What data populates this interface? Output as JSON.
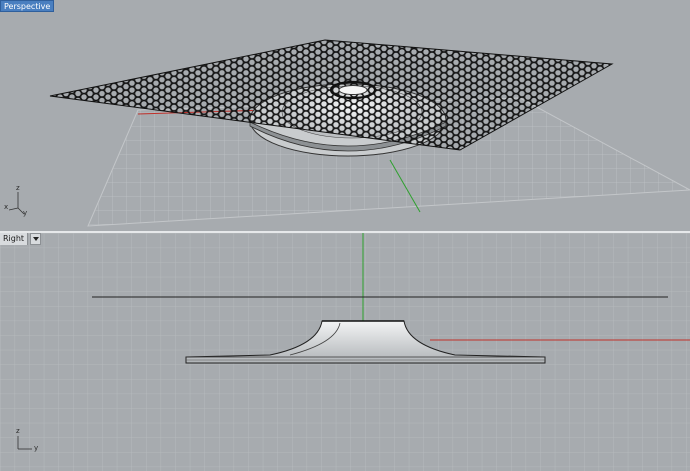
{
  "viewports": {
    "top": {
      "label": "Perspective"
    },
    "bottom": {
      "label": "Right"
    }
  },
  "axis_icons": {
    "top": {
      "x": "x",
      "y": "y",
      "z": "z"
    },
    "bottom": {
      "y": "y",
      "z": "z"
    }
  },
  "icons": {
    "dropdown": "chevron-down-icon"
  },
  "colors": {
    "background": "#a7abaf",
    "grid": "#b6babd",
    "x_axis": "#c0302a",
    "y_axis": "#2ea02e",
    "active_label": "#4a7fc0"
  }
}
